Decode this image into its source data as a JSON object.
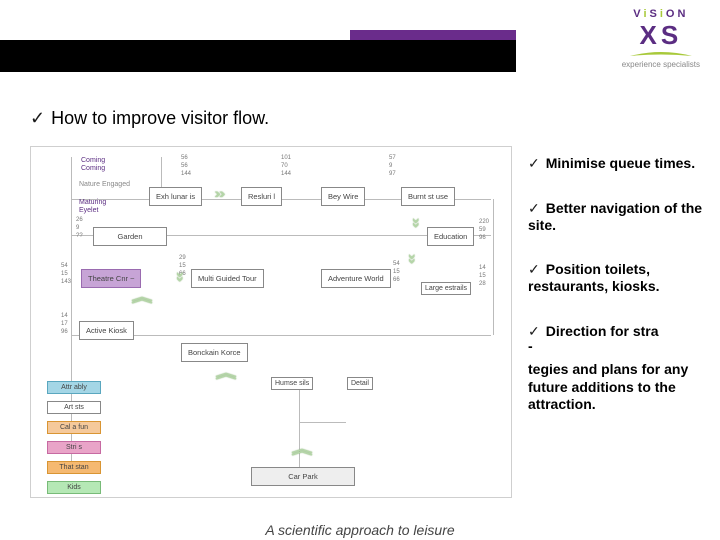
{
  "logo": {
    "v": "V",
    "i": "i",
    "s": "S",
    "o": "O",
    "n": "N",
    "xs": "XS",
    "tagline": "experience specialists"
  },
  "title": "How to improve visitor flow.",
  "check": "✓",
  "side": {
    "b1": "Minimise queue times.",
    "b2": "Better navigation of the site.",
    "b3": "Position toilets, restaurants, kiosks.",
    "b4": "Direction for stra",
    "dash": "-",
    "b5": "tegies and plans for any future additions to the attraction."
  },
  "dg": {
    "top": {
      "l1": "Coming",
      "l2": "Coming",
      "l3": "Nature Engaged",
      "l4": "Maturing",
      "l5": "Eyelet"
    },
    "metrics": {
      "c1a": "56",
      "c1b": "56",
      "c1c": "144",
      "c2a": "101",
      "c2b": "70",
      "c2c": "144",
      "c3a": "57",
      "c3b": "9",
      "c3c": "97"
    },
    "row1": {
      "a": "Exh lunar   is",
      "b": "Resluri l",
      "c": "Bey Wire",
      "d": "Burnt st use"
    },
    "garden": {
      "lbl": "Garden",
      "side": {
        "a": "26",
        "b": "9",
        "c": "??"
      }
    },
    "row2": {
      "educ": "Education",
      "s": {
        "a": "220",
        "b": "59",
        "c": "96"
      }
    },
    "row3": {
      "theatre": "Theatre Cnr ~",
      "multi": "Multi Guided Tour",
      "adv": "Adventure World",
      "large": "Large estrails",
      "m": {
        "a": "54",
        "b": "15",
        "c": "143"
      },
      "a": {
        "a": "29",
        "b": "15",
        "c": "66"
      },
      "e": {
        "a": "54",
        "b": "15",
        "c": "66"
      },
      "l": {
        "a": "14",
        "b": "15",
        "c": "28"
      }
    },
    "row4": {
      "act": "Active Kiosk",
      "bon": "Bonckain Korce",
      "t": {
        "a": "14",
        "b": "17",
        "c": "96"
      }
    },
    "row5": {
      "humse": "Humse sils",
      "det": "Detail"
    },
    "legend": {
      "a": "Attr ably",
      "b": "Art sts",
      "c": "Cal a fun",
      "d": "Stri s",
      "e": "That stan",
      "f": "Kids"
    },
    "carpark": "Car Park"
  },
  "footer": "A scientific approach to leisure"
}
